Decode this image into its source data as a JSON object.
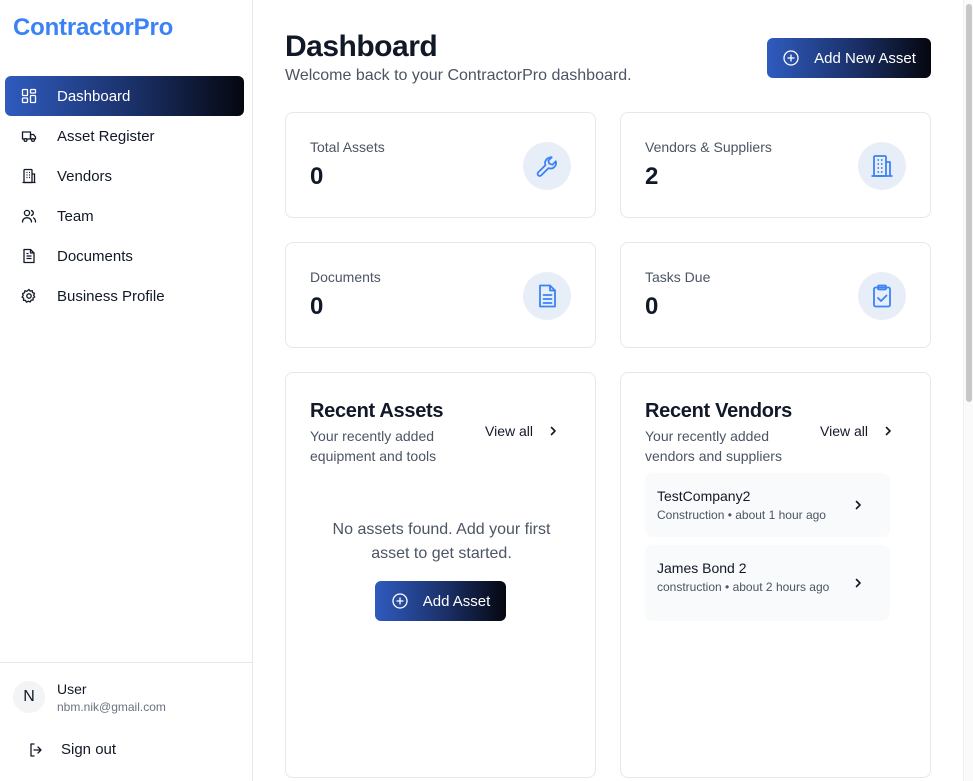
{
  "brand": {
    "name": "ContractorPro",
    "color": "#3b82f6"
  },
  "sidebar": {
    "items": [
      {
        "label": "Dashboard",
        "icon": "dashboard-grid-icon",
        "active": true
      },
      {
        "label": "Asset Register",
        "icon": "truck-icon",
        "active": false
      },
      {
        "label": "Vendors",
        "icon": "building-icon",
        "active": false
      },
      {
        "label": "Team",
        "icon": "users-icon",
        "active": false
      },
      {
        "label": "Documents",
        "icon": "document-icon",
        "active": false
      },
      {
        "label": "Business Profile",
        "icon": "gear-icon",
        "active": false
      }
    ],
    "user": {
      "initial": "N",
      "name": "User",
      "email": "nbm.nik@gmail.com"
    },
    "signout_label": "Sign out"
  },
  "header": {
    "title": "Dashboard",
    "subtitle": "Welcome back to your ContractorPro dashboard.",
    "add_new_asset_label": "Add New Asset"
  },
  "stats": [
    {
      "label": "Total Assets",
      "value": "0",
      "icon": "wrench-icon"
    },
    {
      "label": "Vendors & Suppliers",
      "value": "2",
      "icon": "building-icon"
    },
    {
      "label": "Documents",
      "value": "0",
      "icon": "document-icon"
    },
    {
      "label": "Tasks Due",
      "value": "0",
      "icon": "clipboard-check-icon"
    }
  ],
  "recent_assets": {
    "title": "Recent Assets",
    "description": "Your recently added equipment and tools",
    "view_all_label": "View all",
    "empty_message": "No assets found. Add your first asset to get started.",
    "add_button_label": "Add Asset"
  },
  "recent_vendors": {
    "title": "Recent Vendors",
    "description": "Your recently added vendors and suppliers",
    "view_all_label": "View all",
    "items": [
      {
        "name": "TestCompany2",
        "meta": "Construction • about 1 hour ago"
      },
      {
        "name": "James Bond 2",
        "meta": "construction • about 2 hours ago"
      }
    ]
  },
  "colors": {
    "accent_start": "#2f5bbf",
    "accent_end": "#05070f",
    "icon_blue": "#3b82f6",
    "icon_bg": "#e8eef8"
  }
}
